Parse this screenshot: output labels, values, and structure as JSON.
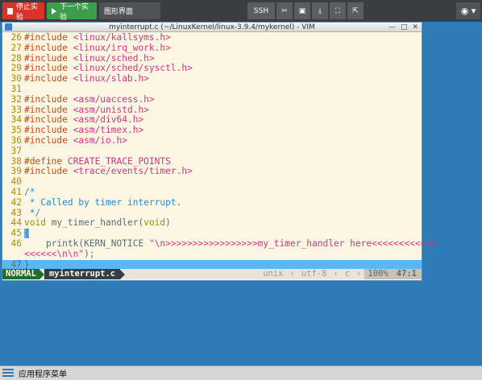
{
  "toolbar": {
    "stop_label": "停止实验",
    "next_label": "下一个实验",
    "tab_label": "图形界面",
    "ssh_label": "SSH",
    "tools": [
      "scissors-icon",
      "clipboard-icon",
      "download-icon",
      "fullscreen-icon",
      "popout-icon"
    ],
    "eye_label": "◉ ▾"
  },
  "window": {
    "title": "myinterrupt.c (~/LinuxKernel/linux-3.9.4/mykernel) - VIM",
    "buttons": [
      "—",
      "□",
      "✕"
    ]
  },
  "editor": {
    "lines": [
      {
        "n": "26",
        "parts": [
          {
            "c": "pp",
            "t": "#include "
          },
          {
            "c": "inc",
            "t": "<linux/kallsyms.h>"
          }
        ]
      },
      {
        "n": "27",
        "parts": [
          {
            "c": "pp",
            "t": "#include "
          },
          {
            "c": "inc",
            "t": "<linux/irq_work.h>"
          }
        ]
      },
      {
        "n": "28",
        "parts": [
          {
            "c": "pp",
            "t": "#include "
          },
          {
            "c": "inc",
            "t": "<linux/sched.h>"
          }
        ]
      },
      {
        "n": "29",
        "parts": [
          {
            "c": "pp",
            "t": "#include "
          },
          {
            "c": "inc",
            "t": "<linux/sched/sysctl.h>"
          }
        ]
      },
      {
        "n": "30",
        "parts": [
          {
            "c": "pp",
            "t": "#include "
          },
          {
            "c": "inc",
            "t": "<linux/slab.h>"
          }
        ]
      },
      {
        "n": "31",
        "parts": []
      },
      {
        "n": "32",
        "parts": [
          {
            "c": "pp",
            "t": "#include "
          },
          {
            "c": "inc",
            "t": "<asm/uaccess.h>"
          }
        ]
      },
      {
        "n": "33",
        "parts": [
          {
            "c": "pp",
            "t": "#include "
          },
          {
            "c": "inc",
            "t": "<asm/unistd.h>"
          }
        ]
      },
      {
        "n": "34",
        "parts": [
          {
            "c": "pp",
            "t": "#include "
          },
          {
            "c": "inc",
            "t": "<asm/div64.h>"
          }
        ]
      },
      {
        "n": "35",
        "parts": [
          {
            "c": "pp",
            "t": "#include "
          },
          {
            "c": "inc",
            "t": "<asm/timex.h>"
          }
        ]
      },
      {
        "n": "36",
        "parts": [
          {
            "c": "pp",
            "t": "#include "
          },
          {
            "c": "inc",
            "t": "<asm/io.h>"
          }
        ]
      },
      {
        "n": "37",
        "parts": []
      },
      {
        "n": "38",
        "parts": [
          {
            "c": "pp",
            "t": "#define "
          },
          {
            "c": "inc",
            "t": "CREATE_TRACE_POINTS"
          }
        ]
      },
      {
        "n": "39",
        "parts": [
          {
            "c": "pp",
            "t": "#include "
          },
          {
            "c": "inc",
            "t": "<trace/events/timer.h>"
          }
        ]
      },
      {
        "n": "40",
        "parts": []
      },
      {
        "n": "41",
        "parts": [
          {
            "c": "cm",
            "t": "/*"
          }
        ]
      },
      {
        "n": "42",
        "parts": [
          {
            "c": "cm",
            "t": " * Called by timer interrupt."
          }
        ]
      },
      {
        "n": "43",
        "parts": [
          {
            "c": "cm",
            "t": " */"
          }
        ]
      },
      {
        "n": "44",
        "parts": [
          {
            "c": "kw",
            "t": "void"
          },
          {
            "c": "fn",
            "t": " my_timer_handler("
          },
          {
            "c": "kw",
            "t": "void"
          },
          {
            "c": "fn",
            "t": ")"
          }
        ]
      },
      {
        "n": "45",
        "parts": [
          {
            "c": "cur",
            "t": "{"
          }
        ]
      },
      {
        "n": "46",
        "parts": [
          {
            "c": "fn",
            "t": "    printk(KERN_NOTICE "
          },
          {
            "c": "inc",
            "t": "\"\\n>>>>>>>>>>>>>>>>>my_timer_handler here<<<<<<<<<<<<"
          }
        ]
      },
      {
        "n": "",
        "parts": [
          {
            "c": "inc",
            "t": "<<<<<<\\n\\n\""
          },
          {
            "c": "fn",
            "t": ");"
          }
        ]
      },
      {
        "n": "47",
        "parts": [
          {
            "c": "cur",
            "t": "}"
          }
        ],
        "highlight": true
      }
    ]
  },
  "status": {
    "mode": "NORMAL",
    "filename": "myinterrupt.c",
    "format": "unix",
    "encoding": "utf-8",
    "filetype": "c",
    "percent": "100%",
    "position": "47:1"
  },
  "taskbar": {
    "menu_label": "应用程序菜单"
  }
}
